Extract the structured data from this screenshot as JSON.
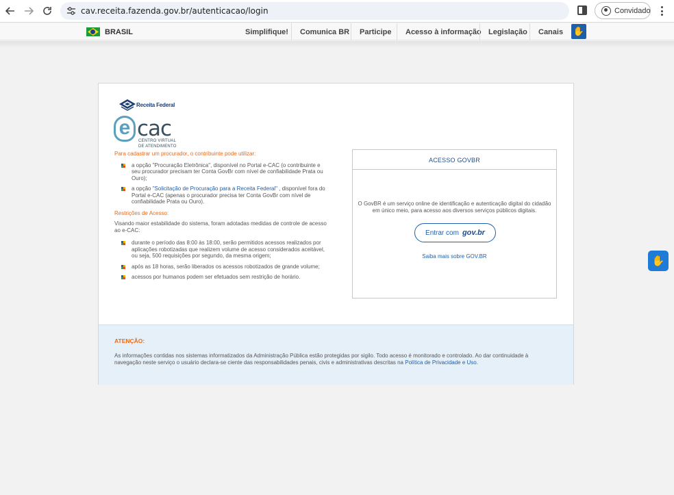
{
  "browser": {
    "url": "cav.receita.fazenda.gov.br/autenticacao/login",
    "profile_label": "Convidado",
    "icons": [
      "back-arrow-icon",
      "forward-arrow-icon",
      "reload-icon",
      "site-settings-icon",
      "side-panel-icon",
      "profile-icon",
      "more-menu-icon"
    ]
  },
  "govbar": {
    "country": "BRASIL",
    "links": [
      "Simplifique!",
      "Comunica BR",
      "Participe",
      "Acesso à informação",
      "Legislação",
      "Canais"
    ],
    "accessibility_icon": "sign-language-icon"
  },
  "logos": {
    "receita": "Receita Federal",
    "ecac_letter": "e",
    "ecac_word": "cac",
    "ecac_sub1": "CENTRO VIRTUAL",
    "ecac_sub2": "DE ATENDIMENTO"
  },
  "procurador": {
    "heading": "Para cadastrar um procurador, o contribuinte pode utilizar:",
    "item1": "a opção \"Procuração Eletrônica\", disponível no Portal e-CAC (o contribuinte e seu procurador precisam ter Conta GovBr com nível de confiabilidade Prata ou Ouro);",
    "item2_pre": "a opção ",
    "item2_link": "\"Solicitação de Procuração para a Receita Federal\"",
    "item2_post": " , disponível fora do Portal e-CAC (apenas o procurador precisa ter Conta GovBr com nível de confiabilidade Prata ou Ouro)."
  },
  "restricoes": {
    "heading": "Restrições de Acesso:",
    "intro": "Visando maior estabilidade do sistema, foram adotadas medidas de controle de acesso ao e-CAC:",
    "items": [
      "durante o período das 8:00 às 18:00, serão permitidos acessos realizados por aplicações robotizadas que realizem volume de acesso considerados aceitável, ou seja, 500 requisições por segundo, da mesma origem;",
      "após as 18 horas, serão liberados os acessos robotizados de grande volume;",
      "acessos por humanos podem ser efetuados sem restrição de horário."
    ]
  },
  "acesso": {
    "title": "ACESSO GOVBR",
    "description": "O GovBR é um serviço online de identificação e autenticação digital do cidadão em único meio, para acesso aos diversos serviços públicos digitais.",
    "button_text": "Entrar com",
    "button_brand": "gov.br",
    "saiba_mais": "Saiba mais sobre GOV.BR"
  },
  "atencao": {
    "title": "ATENÇÃO:",
    "text": "As informações contidas nos sistemas informatizados da Administração Pública estão protegidas por sigilo. Todo acesso é monitorado e controlado. Ao dar continuidade à navegação neste serviço o usuário declara-se ciente das responsabilidades penais, civis e administrativas descritas na ",
    "link": "Política de Privacidade e Uso",
    "end": "."
  },
  "colors": {
    "accent_orange": "#e86a1c",
    "link_blue": "#1f5ea8",
    "attention_bg": "#e6f0f8"
  }
}
